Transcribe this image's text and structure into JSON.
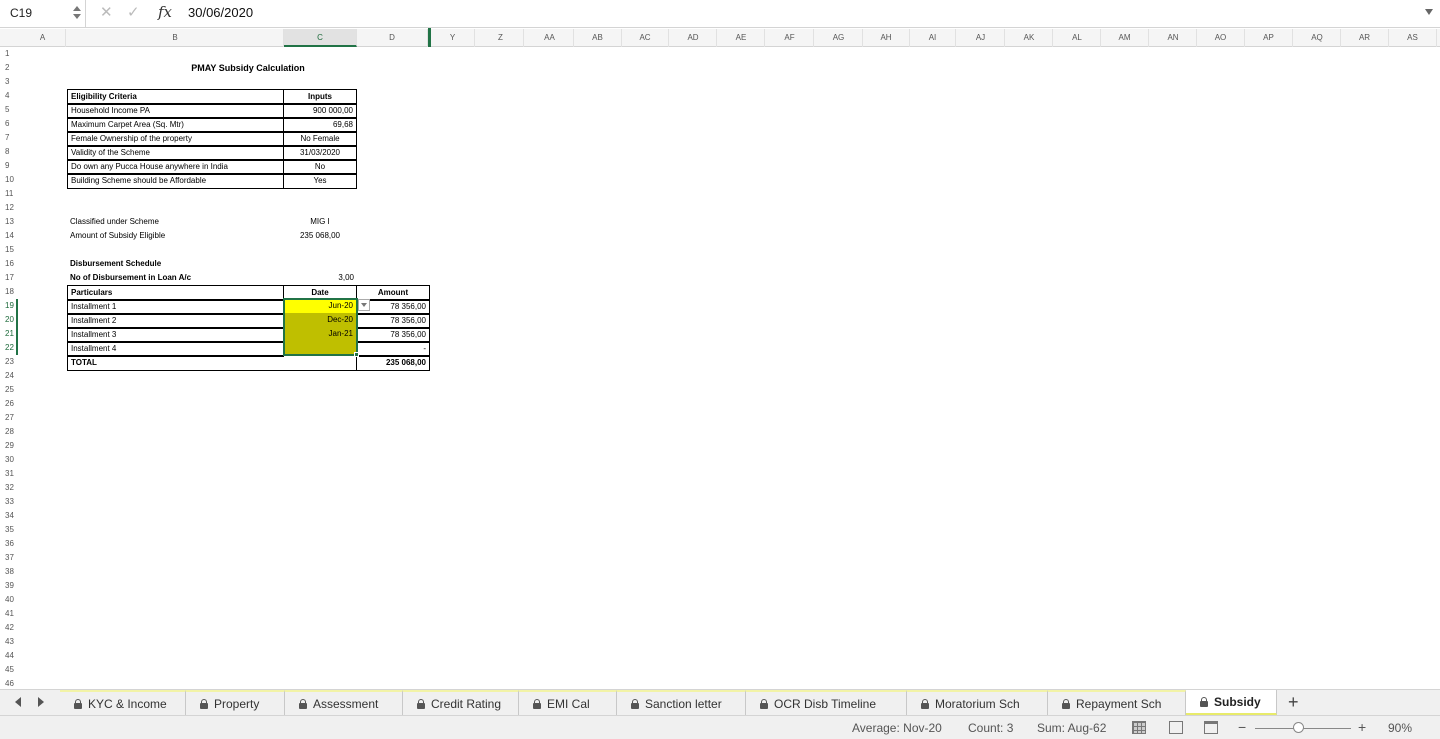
{
  "formula_bar": {
    "name_box": "C19",
    "cancel_symbol": "✕",
    "enter_symbol": "✓",
    "fx_label": "fx",
    "value": "30/06/2020"
  },
  "columns": [
    "A",
    "B",
    "C",
    "D",
    "Y",
    "Z",
    "AA",
    "AB",
    "AC",
    "AD",
    "AE",
    "AF",
    "AG",
    "AH",
    "AI",
    "AJ",
    "AK",
    "AL",
    "AM",
    "AN",
    "AO",
    "AP",
    "AQ",
    "AR",
    "AS"
  ],
  "selected_column": "C",
  "rows": [
    "1",
    "2",
    "3",
    "4",
    "5",
    "6",
    "7",
    "8",
    "9",
    "10",
    "11",
    "12",
    "13",
    "14",
    "15",
    "16",
    "17",
    "18",
    "19",
    "20",
    "21",
    "22",
    "23",
    "24",
    "25",
    "26",
    "27",
    "28",
    "29",
    "30",
    "31",
    "32",
    "33",
    "34",
    "35",
    "36",
    "37",
    "38",
    "39",
    "40",
    "41",
    "42",
    "43",
    "44",
    "45",
    "46"
  ],
  "selected_rows": [
    "19",
    "20",
    "21",
    "22"
  ],
  "sheet": {
    "title": "PMAY Subsidy Calculation",
    "eligibility": {
      "header_label": "Eligibility Criteria",
      "header_value": "Inputs",
      "rows": [
        {
          "label": "Household Income PA",
          "value": "900 000,00"
        },
        {
          "label": "Maximum Carpet Area (Sq. Mtr)",
          "value": "69,68"
        },
        {
          "label": "Female Ownership of the property",
          "value": "No Female"
        },
        {
          "label": "Validity of the Scheme",
          "value": "31/03/2020"
        },
        {
          "label": "Do own any Pucca House anywhere in India",
          "value": "No"
        },
        {
          "label": "Building Scheme should be Affordable",
          "value": "Yes"
        }
      ]
    },
    "classified_label": "Classified under Scheme",
    "classified_value": "MIG I",
    "subsidy_label": "Amount of Subsidy Eligible",
    "subsidy_value": "235 068,00",
    "disbursement_title": "Disbursement Schedule",
    "no_disb_label": "No of Disbursement in Loan A/c",
    "no_disb_value": "3,00",
    "schedule": {
      "headers": [
        "Particulars",
        "Date",
        "Amount"
      ],
      "rows": [
        {
          "particular": "Installment 1",
          "date": "Jun-20",
          "amount": "78 356,00"
        },
        {
          "particular": "Installment 2",
          "date": "Dec-20",
          "amount": "78 356,00"
        },
        {
          "particular": "Installment 3",
          "date": "Jan-21",
          "amount": "78 356,00"
        },
        {
          "particular": "Installment 4",
          "date": "",
          "amount": "-"
        }
      ],
      "total_label": "TOTAL",
      "total_value": "235 068,00"
    }
  },
  "tabs": [
    {
      "label": "KYC & Income",
      "locked": true
    },
    {
      "label": "Property",
      "locked": true
    },
    {
      "label": "Assessment",
      "locked": true
    },
    {
      "label": "Credit Rating",
      "locked": true
    },
    {
      "label": "EMI Cal",
      "locked": true
    },
    {
      "label": "Sanction letter",
      "locked": true
    },
    {
      "label": "OCR Disb Timeline",
      "locked": true
    },
    {
      "label": "Moratorium Sch",
      "locked": true
    },
    {
      "label": "Repayment Sch",
      "locked": true
    },
    {
      "label": "Subsidy",
      "locked": true,
      "active": true
    }
  ],
  "add_sheet": "+",
  "status": {
    "average": "Average: Nov-20",
    "count": "Count: 3",
    "sum": "Sum: Aug-62",
    "zoom_minus": "−",
    "zoom_plus": "+",
    "zoom": "90%",
    "zoom_level_percent": 90
  },
  "colors": {
    "accent": "#217346",
    "highlight_yellow": "#ffff00",
    "highlight_olive": "#bfbf00",
    "tab_underline": "#e8eb6a"
  }
}
